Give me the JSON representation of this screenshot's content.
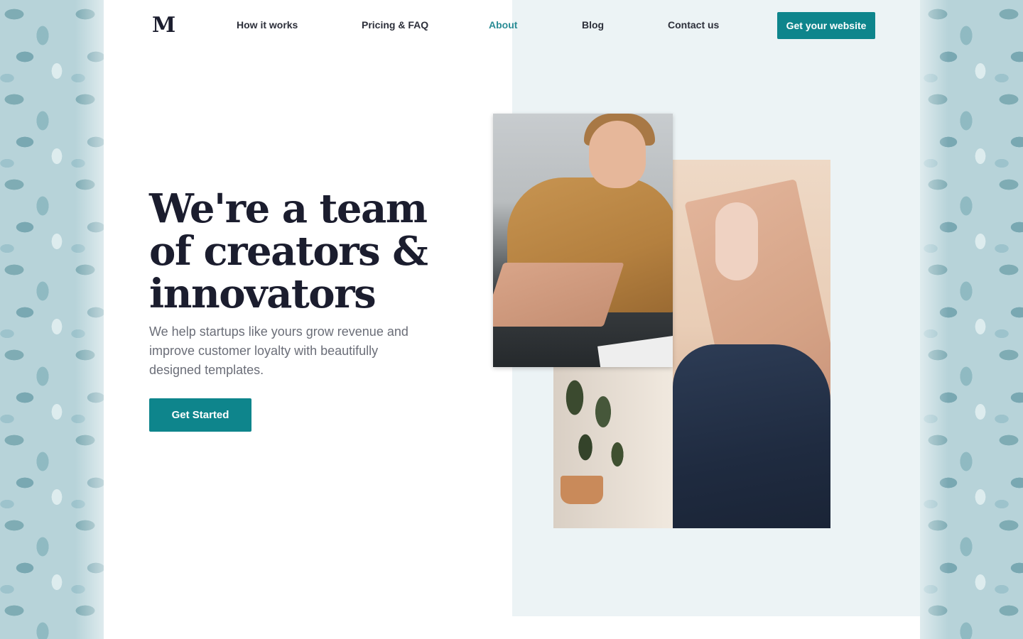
{
  "nav": {
    "logo": "M",
    "links": [
      {
        "label": "How it works",
        "active": false
      },
      {
        "label": "Pricing & FAQ",
        "active": false
      },
      {
        "label": "About",
        "active": true
      },
      {
        "label": "Blog",
        "active": false
      },
      {
        "label": "Contact us",
        "active": false
      }
    ],
    "cta_label": "Get your website"
  },
  "hero": {
    "headline": "We're a team of creators & innovators",
    "subtext": "We help startups like yours grow revenue and improve customer loyalty with beautifully designed templates.",
    "button_label": "Get Started"
  },
  "colors": {
    "accent": "#0e858c",
    "active_link": "#2a8c95",
    "heading": "#1b1d2e",
    "hero_panel": "#ecf3f5"
  }
}
